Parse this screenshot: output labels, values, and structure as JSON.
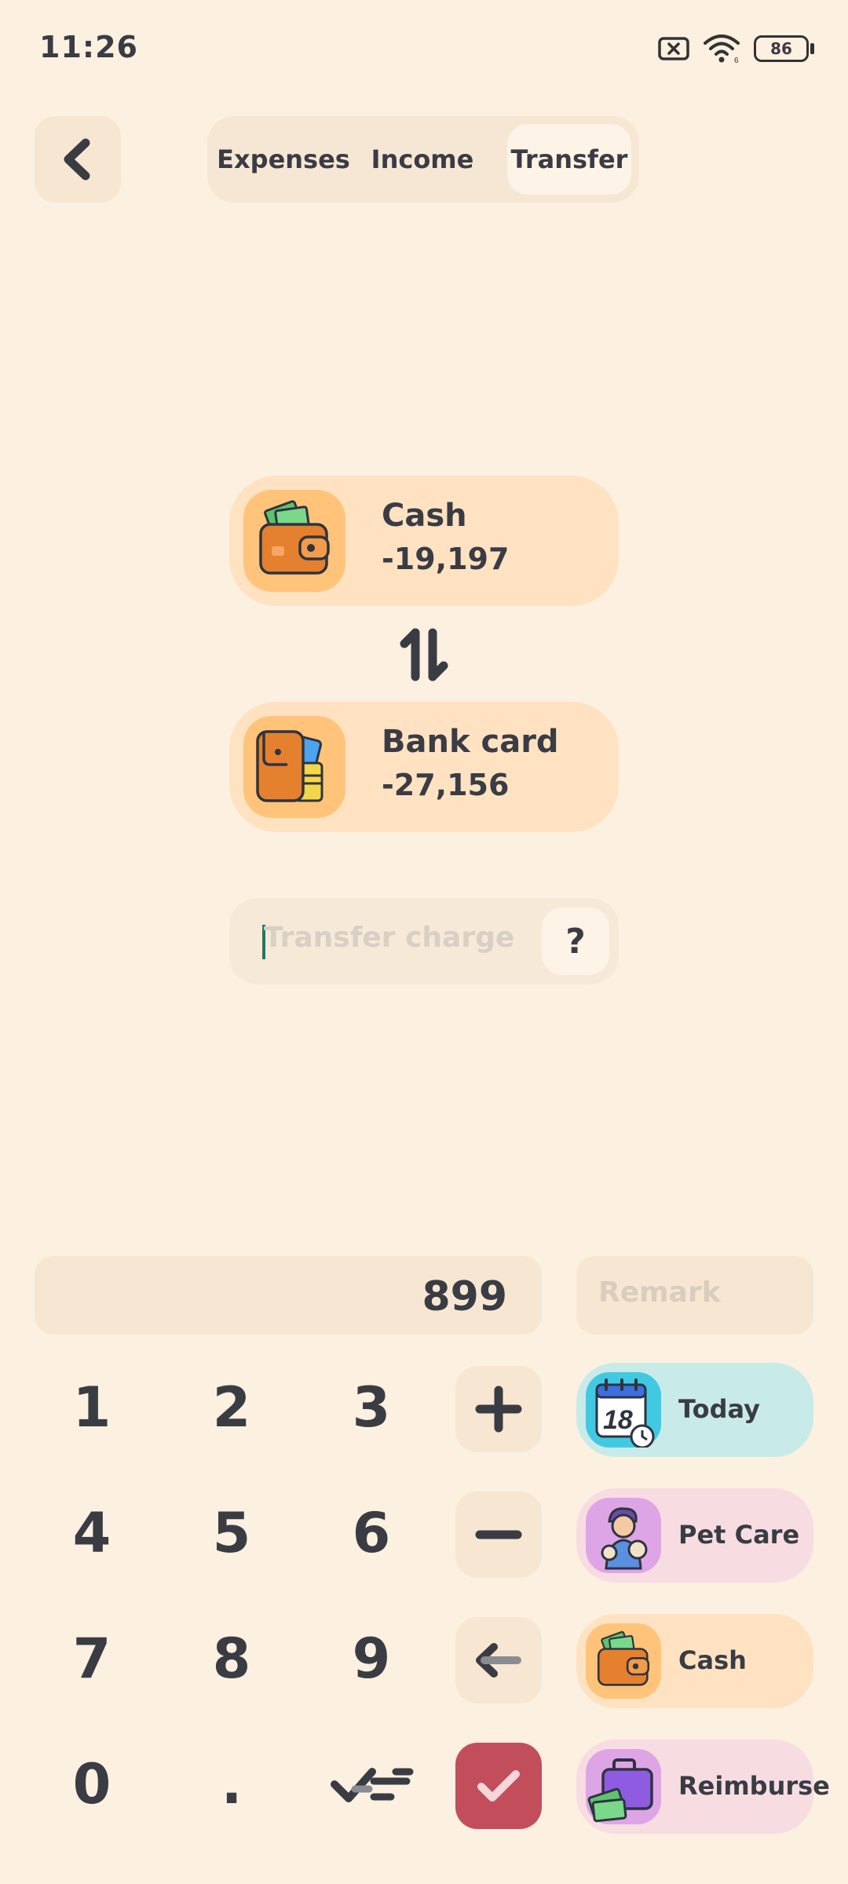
{
  "status_bar": {
    "time": "11:26",
    "battery": "86"
  },
  "header": {
    "tabs": [
      {
        "label": "Expenses",
        "active": false
      },
      {
        "label": "Income",
        "active": false
      },
      {
        "label": "Transfer",
        "active": true
      }
    ]
  },
  "transfer": {
    "from": {
      "name": "Cash",
      "balance": "-19,197",
      "icon": "wallet-cash-icon"
    },
    "to": {
      "name": "Bank card",
      "balance": "-27,156",
      "icon": "wallet-cards-icon"
    },
    "charge_placeholder": "Transfer charge",
    "help_label": "?"
  },
  "keypad": {
    "amount": "899",
    "remark_placeholder": "Remark",
    "keys": [
      "1",
      "2",
      "3",
      "4",
      "5",
      "6",
      "7",
      "8",
      "9",
      "0",
      "."
    ]
  },
  "side_buttons": [
    {
      "label": "Today",
      "icon": "calendar-icon",
      "color": "#C8EAE8",
      "date_number": "18"
    },
    {
      "label": "Pet Care",
      "icon": "pet-care-icon",
      "color": "#F7DCE2"
    },
    {
      "label": "Cash",
      "icon": "wallet-cash-icon",
      "color": "#FFE2C2"
    },
    {
      "label": "Reimburse",
      "icon": "briefcase-money-icon",
      "color": "#F7DCE2"
    }
  ],
  "colors": {
    "background": "#FCF0E0",
    "accent_confirm": "#C24E5C",
    "text": "#3A3C44"
  }
}
